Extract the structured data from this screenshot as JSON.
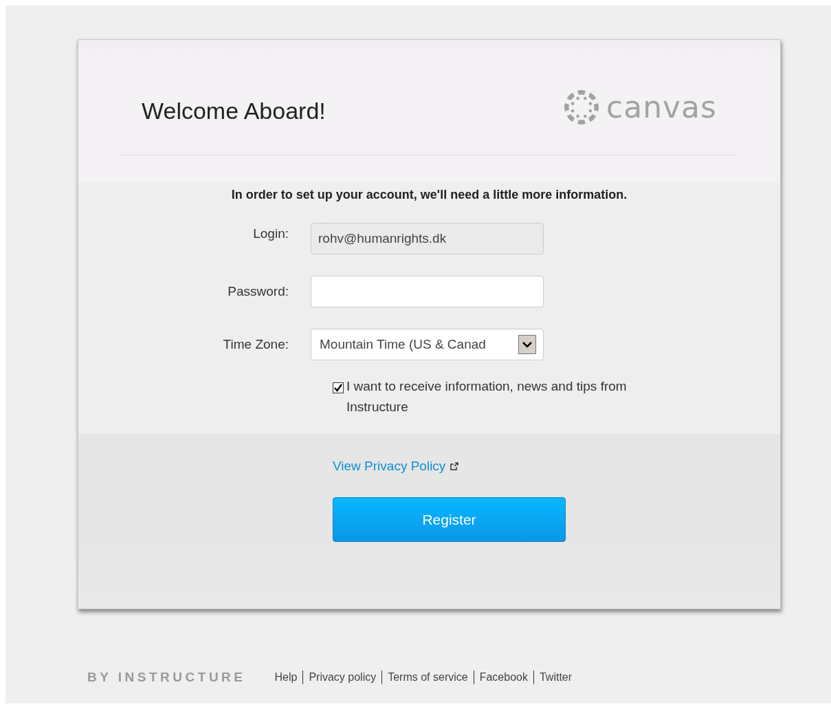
{
  "header": {
    "title": "Welcome Aboard!",
    "logo": "canvas"
  },
  "intro": "In order to set up your account, we'll need a little more information.",
  "fields": [
    {
      "kind": "readonly",
      "label": "Login:",
      "value": "rohv@humanrights.dk"
    },
    {
      "kind": "password",
      "label": "Password:"
    },
    {
      "kind": "select",
      "label": "Time Zone:",
      "value": "Mountain Time (US & Canad"
    }
  ],
  "newsletter": {
    "checked": true,
    "label": "I want to receive information, news and tips from Instructure"
  },
  "privacy_link": "View Privacy Policy",
  "register_button": "Register",
  "footer": {
    "brand": "BY INSTRUCTURE",
    "links": [
      "Help",
      "Privacy policy",
      "Terms of service",
      "Facebook",
      "Twitter"
    ]
  }
}
